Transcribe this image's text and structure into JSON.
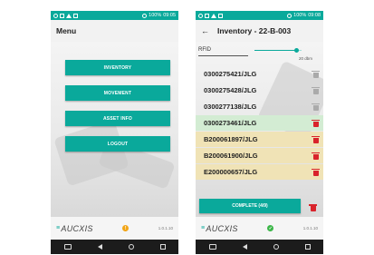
{
  "status_bar": {
    "battery": "100%",
    "time": "09:05",
    "battery_icon": "battery-icon"
  },
  "status_bar_right": {
    "battery": "100%",
    "time": "09:08"
  },
  "menu_screen": {
    "title": "Menu",
    "buttons": [
      "INVENTORY",
      "MOVEMENT",
      "ASSET INFO",
      "LOGOUT"
    ],
    "footer": {
      "logo": "AUCXIS",
      "version": "1.0.1.10",
      "status": "!",
      "status_color": "#f2a516"
    }
  },
  "inventory_screen": {
    "title": "Inventory - 22-B-003",
    "rfid_label": "RFID",
    "rfid_power": "20 dbm",
    "slider_level": 0.9,
    "items": [
      {
        "tag": "0300275421/JLG",
        "state": "pending"
      },
      {
        "tag": "0300275428/JLG",
        "state": "pending"
      },
      {
        "tag": "0300277138/JLG",
        "state": "pending"
      },
      {
        "tag": "0300273461/JLG",
        "state": "found"
      },
      {
        "tag": "B200061897/JLG",
        "state": "extra"
      },
      {
        "tag": "B200061900/JLG",
        "state": "extra"
      },
      {
        "tag": "E200000657/JLG",
        "state": "extra"
      }
    ],
    "complete_label": "COMPLETE (4/9)",
    "footer": {
      "logo": "AUCXIS",
      "version": "1.0.1.10",
      "status": "✓",
      "status_color": "#3cb648"
    }
  },
  "colors": {
    "accent": "#0aa99b",
    "found_row": "#d3ecd3",
    "extra_row": "#f0e3b6",
    "delete_red": "#d9232b"
  }
}
